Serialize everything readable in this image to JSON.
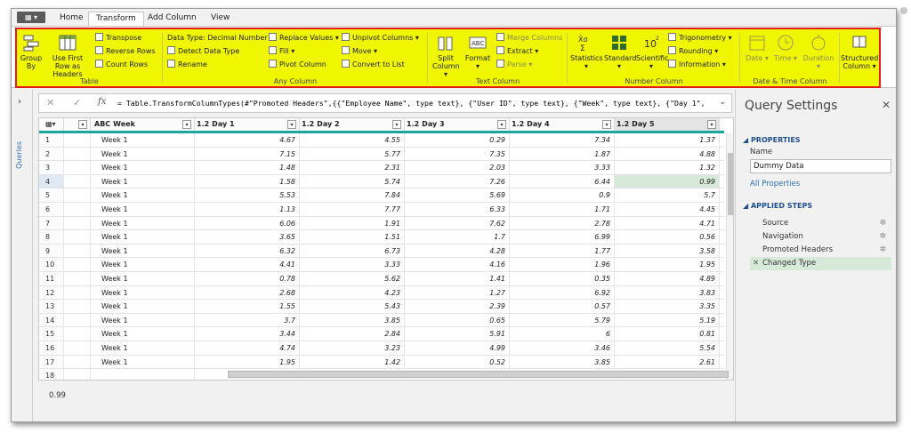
{
  "tabs": [
    "Home",
    "Transform",
    "Add Column",
    "View"
  ],
  "ribbon": {
    "table": {
      "group_by": "Group By",
      "use_first_row": "Use First Row as Headers",
      "transpose": "Transpose",
      "reverse_rows": "Reverse Rows",
      "count_rows": "Count Rows",
      "label": "Table"
    },
    "any": {
      "data_type": "Data Type: Decimal Number",
      "detect": "Detect Data Type",
      "rename": "Rename",
      "replace": "Replace Values",
      "fill": "Fill",
      "pivot": "Pivot Column",
      "unpivot": "Unpivot Columns",
      "move": "Move",
      "to_list": "Convert to List",
      "label": "Any Column"
    },
    "text": {
      "split": "Split Column",
      "format": "Format",
      "merge": "Merge Columns",
      "extract": "Extract",
      "parse": "Parse",
      "label": "Text Column"
    },
    "number": {
      "statistics": "Statistics",
      "standard": "Standard",
      "scientific": "Scientific",
      "trig": "Trigonometry",
      "rounding": "Rounding",
      "information": "Information",
      "label": "Number Column"
    },
    "datetime": {
      "date": "Date",
      "time": "Time",
      "duration": "Duration",
      "label": "Date & Time Column"
    },
    "structured": {
      "label": "Structured Column"
    }
  },
  "queries_label": "Queries",
  "formula": "= Table.TransformColumnTypes(#\"Promoted Headers\",{{\"Employee Name\", type text}, {\"User ID\", type text}, {\"Week\", type text}, {\"Day 1\",",
  "columns": [
    {
      "type": "ABC",
      "name": "Week"
    },
    {
      "type": "1.2",
      "name": "Day 1"
    },
    {
      "type": "1.2",
      "name": "Day 2"
    },
    {
      "type": "1.2",
      "name": "Day 3"
    },
    {
      "type": "1.2",
      "name": "Day 4"
    },
    {
      "type": "1.2",
      "name": "Day 5"
    }
  ],
  "rows": [
    [
      "1",
      "Week 1",
      "4.67",
      "4.55",
      "0.29",
      "7.34",
      "1.37"
    ],
    [
      "2",
      "Week 1",
      "7.15",
      "5.77",
      "7.35",
      "1.87",
      "4.88"
    ],
    [
      "3",
      "Week 1",
      "1.48",
      "2.31",
      "2.03",
      "3.33",
      "1.32"
    ],
    [
      "4",
      "Week 1",
      "1.58",
      "5.74",
      "7.26",
      "6.44",
      "0.99"
    ],
    [
      "5",
      "Week 1",
      "5.53",
      "7.84",
      "5.69",
      "0.9",
      "5.7"
    ],
    [
      "6",
      "Week 1",
      "1.13",
      "7.77",
      "6.33",
      "1.71",
      "4.45"
    ],
    [
      "7",
      "Week 1",
      "6.06",
      "1.91",
      "7.62",
      "2.78",
      "4.71"
    ],
    [
      "8",
      "Week 1",
      "3.65",
      "1.51",
      "1.7",
      "6.99",
      "0.56"
    ],
    [
      "9",
      "Week 1",
      "6.32",
      "6.73",
      "4.28",
      "1.77",
      "3.58"
    ],
    [
      "10",
      "Week 1",
      "4.41",
      "3.33",
      "4.16",
      "1.96",
      "1.95"
    ],
    [
      "11",
      "Week 1",
      "0.78",
      "5.62",
      "1.41",
      "0.35",
      "4.89"
    ],
    [
      "12",
      "Week 1",
      "2.68",
      "4.23",
      "1.27",
      "6.92",
      "3.83"
    ],
    [
      "13",
      "Week 1",
      "1.55",
      "5.43",
      "2.39",
      "0.57",
      "3.35"
    ],
    [
      "14",
      "Week 1",
      "3.7",
      "3.85",
      "0.65",
      "5.79",
      "5.19"
    ],
    [
      "15",
      "Week 1",
      "3.44",
      "2.84",
      "5.91",
      "6",
      "0.81"
    ],
    [
      "16",
      "Week 1",
      "4.74",
      "3.23",
      "4.99",
      "3.46",
      "5.54"
    ],
    [
      "17",
      "Week 1",
      "1.95",
      "1.42",
      "0.52",
      "3.85",
      "2.61"
    ],
    [
      "18",
      "",
      "",
      "",
      "",
      "",
      ""
    ]
  ],
  "status_value": "0.99",
  "query_settings": {
    "title": "Query Settings",
    "properties": "PROPERTIES",
    "name_label": "Name",
    "name_value": "Dummy Data",
    "all_properties": "All Properties",
    "applied_steps": "APPLIED STEPS",
    "steps": [
      "Source",
      "Navigation",
      "Promoted Headers",
      "Changed Type"
    ]
  },
  "colors": {
    "highlight": "#f0f500",
    "outline": "#e41b1b",
    "accent": "#1aa69a",
    "selected_cell": "#d7ead9"
  }
}
